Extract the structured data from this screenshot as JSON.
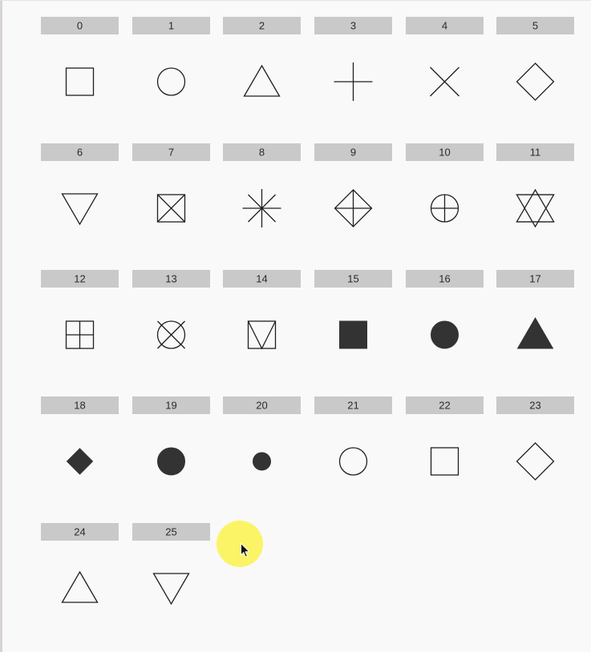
{
  "chart_data": {
    "type": "table",
    "title": "",
    "columns": 6,
    "cells": [
      {
        "code": 0,
        "label": "0",
        "marker": "square-open"
      },
      {
        "code": 1,
        "label": "1",
        "marker": "circle-open"
      },
      {
        "code": 2,
        "label": "2",
        "marker": "triangle-up-open"
      },
      {
        "code": 3,
        "label": "3",
        "marker": "plus"
      },
      {
        "code": 4,
        "label": "4",
        "marker": "cross"
      },
      {
        "code": 5,
        "label": "5",
        "marker": "diamond-open"
      },
      {
        "code": 6,
        "label": "6",
        "marker": "triangle-down-open"
      },
      {
        "code": 7,
        "label": "7",
        "marker": "square-cross"
      },
      {
        "code": 8,
        "label": "8",
        "marker": "asterisk"
      },
      {
        "code": 9,
        "label": "9",
        "marker": "diamond-plus"
      },
      {
        "code": 10,
        "label": "10",
        "marker": "circle-plus"
      },
      {
        "code": 11,
        "label": "11",
        "marker": "star-of-david"
      },
      {
        "code": 12,
        "label": "12",
        "marker": "square-plus"
      },
      {
        "code": 13,
        "label": "13",
        "marker": "circle-cross"
      },
      {
        "code": 14,
        "label": "14",
        "marker": "square-triangle"
      },
      {
        "code": 15,
        "label": "15",
        "marker": "square-filled"
      },
      {
        "code": 16,
        "label": "16",
        "marker": "circle-filled"
      },
      {
        "code": 17,
        "label": "17",
        "marker": "triangle-up-filled"
      },
      {
        "code": 18,
        "label": "18",
        "marker": "diamond-filled-small"
      },
      {
        "code": 19,
        "label": "19",
        "marker": "circle-filled-large"
      },
      {
        "code": 20,
        "label": "20",
        "marker": "circle-filled-small"
      },
      {
        "code": 21,
        "label": "21",
        "marker": "circle-open"
      },
      {
        "code": 22,
        "label": "22",
        "marker": "square-open"
      },
      {
        "code": 23,
        "label": "23",
        "marker": "diamond-open"
      },
      {
        "code": 24,
        "label": "24",
        "marker": "triangle-up-open"
      },
      {
        "code": 25,
        "label": "25",
        "marker": "triangle-down-open"
      }
    ]
  },
  "colors": {
    "background": "#f9f9f9",
    "strip": "#c9c9c9",
    "stroke": "#1f1f1f",
    "fill": "#333333",
    "cursor_highlight": "#fbf35a"
  },
  "cursor": {
    "icon": "mouse-pointer-icon",
    "highlight": "cursor-highlight"
  }
}
